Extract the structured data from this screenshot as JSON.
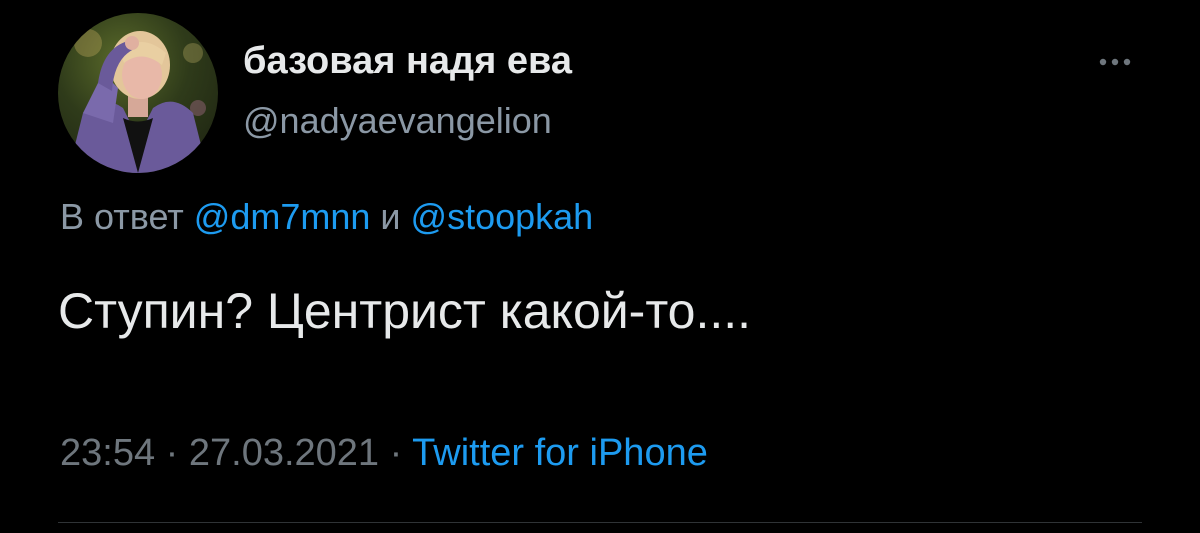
{
  "author": {
    "display_name": "базовая надя ева",
    "handle": "@nadyaevangelion"
  },
  "reply": {
    "prefix": "В ответ",
    "mention_1": "@dm7mnn",
    "conjunction": "и",
    "mention_2": "@stoopkah"
  },
  "tweet": {
    "text": "Ступин? Центрист какой-то...."
  },
  "meta": {
    "time": "23:54",
    "separator_1": "·",
    "date": "27.03.2021",
    "separator_2": "·",
    "source": "Twitter for iPhone"
  },
  "icons": {
    "avatar": "profile-photo",
    "more": "more-options-icon"
  },
  "colors": {
    "background": "#000000",
    "primary_text": "#e7e9ea",
    "secondary_text": "#8b98a5",
    "link": "#1d9bf0"
  }
}
